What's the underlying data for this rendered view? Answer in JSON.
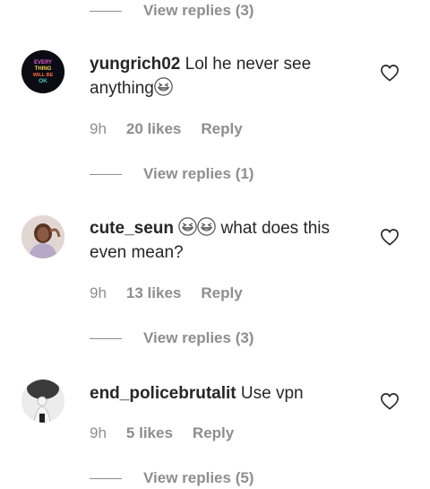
{
  "comments": [
    {
      "username": "yungrich02",
      "text": "Lol he never see anything",
      "emoji": "grinning-squinting-face",
      "time": "9h",
      "likes": "20 likes",
      "reply": "Reply",
      "view_replies": "View replies (1)",
      "avatar_text": [
        "EVERY",
        "THING",
        "WILL BE",
        "OK"
      ]
    },
    {
      "username": "cute_seun",
      "emoji": "grinning-squinting-face",
      "text": "what does this even mean?",
      "time": "9h",
      "likes": "13 likes",
      "reply": "Reply",
      "view_replies": "View replies (3)"
    },
    {
      "username": "end_policebrutalit",
      "text": "Use vpn",
      "time": "9h",
      "likes": "5 likes",
      "reply": "Reply",
      "view_replies": "View replies (5)"
    }
  ],
  "top_view_replies": "View replies (3)",
  "colors": {
    "text": "#262626",
    "secondary": "#8e8e8e",
    "background": "#ffffff"
  }
}
